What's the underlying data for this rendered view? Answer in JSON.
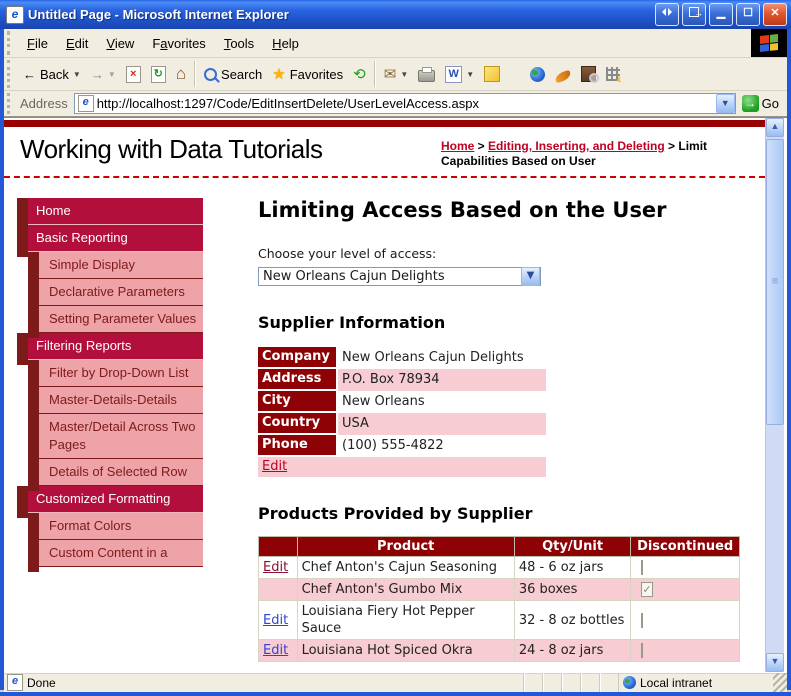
{
  "window": {
    "title": "Untitled Page - Microsoft Internet Explorer",
    "app_icon": "e"
  },
  "menubar": {
    "items": [
      {
        "label": "File",
        "accel": 0
      },
      {
        "label": "Edit",
        "accel": 0
      },
      {
        "label": "View",
        "accel": 0
      },
      {
        "label": "Favorites",
        "accel": 1
      },
      {
        "label": "Tools",
        "accel": 0
      },
      {
        "label": "Help",
        "accel": 0
      }
    ]
  },
  "toolbar": {
    "back_label": "Back",
    "search_label": "Search",
    "favorites_label": "Favorites",
    "icons": [
      "back-icon",
      "back-dropdown-icon",
      "forward-icon",
      "forward-dropdown-icon",
      "stop-icon",
      "refresh-icon",
      "home-icon",
      "search-icon",
      "favorites-icon",
      "history-icon",
      "mail-icon",
      "mail-dropdown-icon",
      "print-icon",
      "word-edit-icon",
      "word-dropdown-icon",
      "note-icon",
      "globe-search-icon",
      "swoosh-icon",
      "research-icon",
      "messenger-grid-icon"
    ]
  },
  "addressbar": {
    "label": "Address",
    "url": "http://localhost:1297/Code/EditInsertDelete/UserLevelAccess.aspx",
    "go_label": "Go"
  },
  "header": {
    "site_title": "Working with Data Tutorials",
    "breadcrumb": {
      "link1": "Home",
      "sep1": " > ",
      "link2": "Editing, Inserting, and Deleting",
      "sep2": " > ",
      "current": "Limit Capabilities Based on User"
    }
  },
  "sidebar": {
    "items": [
      {
        "label": "Home",
        "level": 1
      },
      {
        "label": "Basic Reporting",
        "level": 1
      },
      {
        "label": "Simple Display",
        "level": 2
      },
      {
        "label": "Declarative Parameters",
        "level": 2
      },
      {
        "label": "Setting Parameter Values",
        "level": 2
      },
      {
        "label": "Filtering Reports",
        "level": 1
      },
      {
        "label": "Filter by Drop-Down List",
        "level": 2
      },
      {
        "label": "Master-Details-Details",
        "level": 2
      },
      {
        "label": "Master/Detail Across Two Pages",
        "level": 2
      },
      {
        "label": "Details of Selected Row",
        "level": 2
      },
      {
        "label": "Customized Formatting",
        "level": 1
      },
      {
        "label": "Format Colors",
        "level": 2
      },
      {
        "label": "Custom Content in a",
        "level": 2
      }
    ]
  },
  "main": {
    "page_title": "Limiting Access Based on the User",
    "access_label": "Choose your level of access:",
    "access_dropdown_value": "New Orleans Cajun Delights",
    "supplier_section": {
      "heading": "Supplier Information",
      "rows": [
        {
          "label": "Company",
          "value": "New Orleans Cajun Delights"
        },
        {
          "label": "Address",
          "value": "P.O. Box 78934"
        },
        {
          "label": "City",
          "value": "New Orleans"
        },
        {
          "label": "Country",
          "value": "USA"
        },
        {
          "label": "Phone",
          "value": "(100) 555-4822"
        }
      ],
      "edit_label": "Edit"
    },
    "products_section": {
      "heading": "Products Provided by Supplier",
      "columns": {
        "edit": "",
        "product": "Product",
        "qty": "Qty/Unit",
        "discontinued": "Discontinued"
      },
      "rows": [
        {
          "edit": "Edit",
          "edit_style": "dark-red",
          "product": "Chef Anton's Cajun Seasoning",
          "qty": "48 - 6 oz jars",
          "discontinued": false
        },
        {
          "edit": "",
          "edit_style": "",
          "product": "Chef Anton's Gumbo Mix",
          "qty": "36 boxes",
          "discontinued": true
        },
        {
          "edit": "Edit",
          "edit_style": "blue",
          "product": "Louisiana Fiery Hot Pepper Sauce",
          "qty": "32 - 8 oz bottles",
          "discontinued": false
        },
        {
          "edit": "Edit",
          "edit_style": "blue",
          "product": "Louisiana Hot Spiced Okra",
          "qty": "24 - 8 oz jars",
          "discontinued": false
        }
      ]
    }
  },
  "statusbar": {
    "status": "Done",
    "zone": "Local intranet"
  },
  "colors": {
    "sidebar_level1_bg": "#b20f3c",
    "sidebar_tab": "#7d1a1a",
    "sidebar_level2_bg": "#eda3a8",
    "table_header_bg": "#8e0205",
    "table_alt_row_bg": "#f7ccd2",
    "site_link_red": "#c00125",
    "grid_link_blue": "#3344cc",
    "top_rule": "#990000",
    "titlebar_blue": "#2a63e0"
  }
}
